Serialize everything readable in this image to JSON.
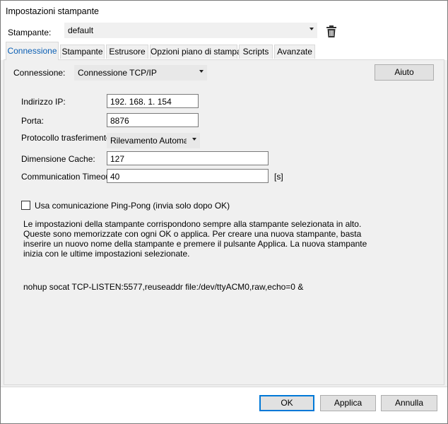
{
  "window": {
    "title": "Impostazioni stampante"
  },
  "printer": {
    "label": "Stampante:",
    "selected": "default",
    "delete_icon": "trash-icon"
  },
  "tabs": [
    {
      "label": "Connessione",
      "active": true
    },
    {
      "label": "Stampante",
      "active": false
    },
    {
      "label": "Estrusore",
      "active": false
    },
    {
      "label": "Opzioni piano di stampa",
      "active": false
    },
    {
      "label": "Scripts",
      "active": false
    },
    {
      "label": "Avanzate",
      "active": false
    }
  ],
  "connection": {
    "label": "Connessione:",
    "selected": "Connessione TCP/IP",
    "help_label": "Aiuto",
    "ip_label": "Indirizzo IP:",
    "ip_value": "192. 168. 1. 154",
    "port_label": "Porta:",
    "port_value": "8876",
    "protocol_label": "Protocollo trasferimento:",
    "protocol_value": "Rilevamento Automatico",
    "cache_label": "Dimensione Cache:",
    "cache_value": "127",
    "timeout_label": "Communication Timeout:",
    "timeout_value": "40",
    "timeout_unit": "[s]",
    "pingpong_label": "Usa comunicazione Ping-Pong (invia solo dopo OK)",
    "pingpong_checked": false,
    "info_text": "Le impostazioni della stampante corrispondono sempre alla stampante selezionata in alto. Queste sono memorizzate con ogni OK o applica. Per creare una nuova stampante, basta inserire un nuovo nome della stampante e premere il pulsante Applica. La nuova stampante inizia con le ultime impostazioni selezionate.",
    "command_text": "nohup socat TCP-LISTEN:5577,reuseaddr file:/dev/ttyACM0,raw,echo=0 &"
  },
  "footer": {
    "ok_label": "OK",
    "apply_label": "Applica",
    "cancel_label": "Annulla"
  },
  "colors": {
    "accent": "#0078d7",
    "active_tab_text": "#0a5fb4",
    "panel_bg": "#f0f0f0"
  }
}
